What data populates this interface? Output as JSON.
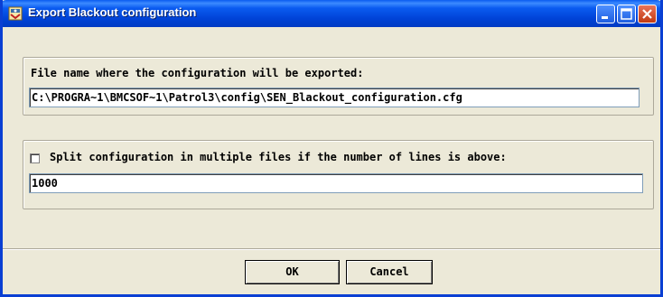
{
  "window": {
    "title": "Export Blackout configuration"
  },
  "export_group": {
    "label": "File name where the configuration will be exported:",
    "file_path": "C:\\PROGRA~1\\BMCSOF~1\\Patrol3\\config\\SEN_Blackout_configuration.cfg"
  },
  "split_group": {
    "checkbox_checked": false,
    "label": "Split configuration in multiple files if the number of lines is above:",
    "line_limit": "1000"
  },
  "buttons": {
    "ok_label": "OK",
    "cancel_label": "Cancel"
  },
  "colors": {
    "titlebar": "#0A5BF0",
    "dialog_bg": "#ECE9D8"
  },
  "icons": [
    "app-icon",
    "minimize-icon",
    "maximize-icon",
    "close-icon"
  ]
}
